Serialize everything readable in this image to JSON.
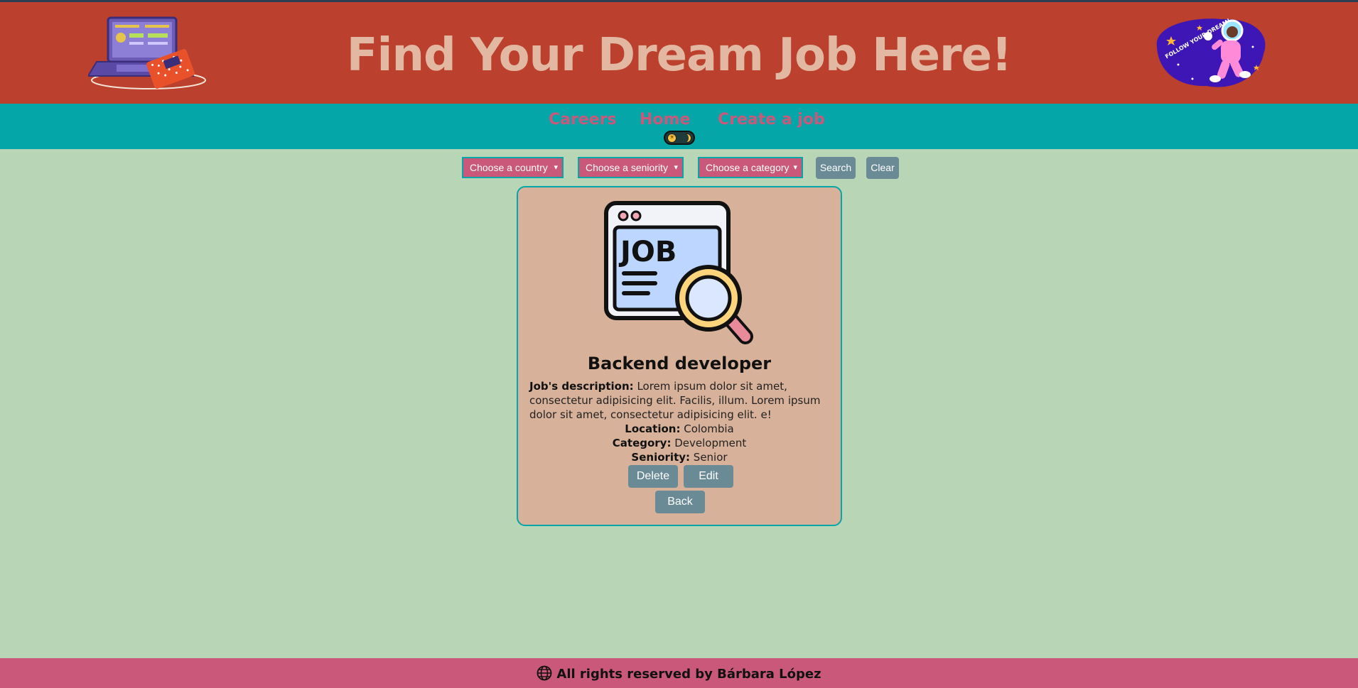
{
  "header": {
    "title": "Find Your Dream Job Here!",
    "left_art": "laptop-illustration",
    "right_art": "astronaut-sticker",
    "right_art_text": "FOLLOW YOUR DREAM!"
  },
  "nav": {
    "items": [
      {
        "label": "Careers"
      },
      {
        "label": "Home"
      },
      {
        "label": "Create a job"
      }
    ],
    "theme_toggle_icons": [
      "sun-icon",
      "moon-icon"
    ]
  },
  "filters": {
    "country": "Choose a country",
    "seniority": "Choose a seniority",
    "category": "Choose a category",
    "search_label": "Search",
    "clear_label": "Clear"
  },
  "job": {
    "illustration_text": "JOB",
    "title": "Backend developer",
    "description_label": "Job's description:",
    "description": "Lorem ipsum dolor sit amet, consectetur adipisicing elit. Facilis, illum. Lorem ipsum dolor sit amet, consectetur adipisicing elit. e!",
    "location_label": "Location:",
    "location": "Colombia",
    "category_label": "Category:",
    "category": "Development",
    "seniority_label": "Seniority:",
    "seniority": "Senior",
    "delete_label": "Delete",
    "edit_label": "Edit",
    "back_label": "Back"
  },
  "footer": {
    "text": "All rights reserved by Bárbara López",
    "icon": "globe-icon"
  },
  "colors": {
    "header_bg": "#bb402d",
    "title_color": "#e2b8a3",
    "nav_bg": "#04a6a8",
    "nav_link": "#c9587a",
    "page_bg": "#b8d5b6",
    "card_bg": "#d8b19a",
    "button_bg": "#6a8a96",
    "footer_bg": "#c9587a"
  }
}
